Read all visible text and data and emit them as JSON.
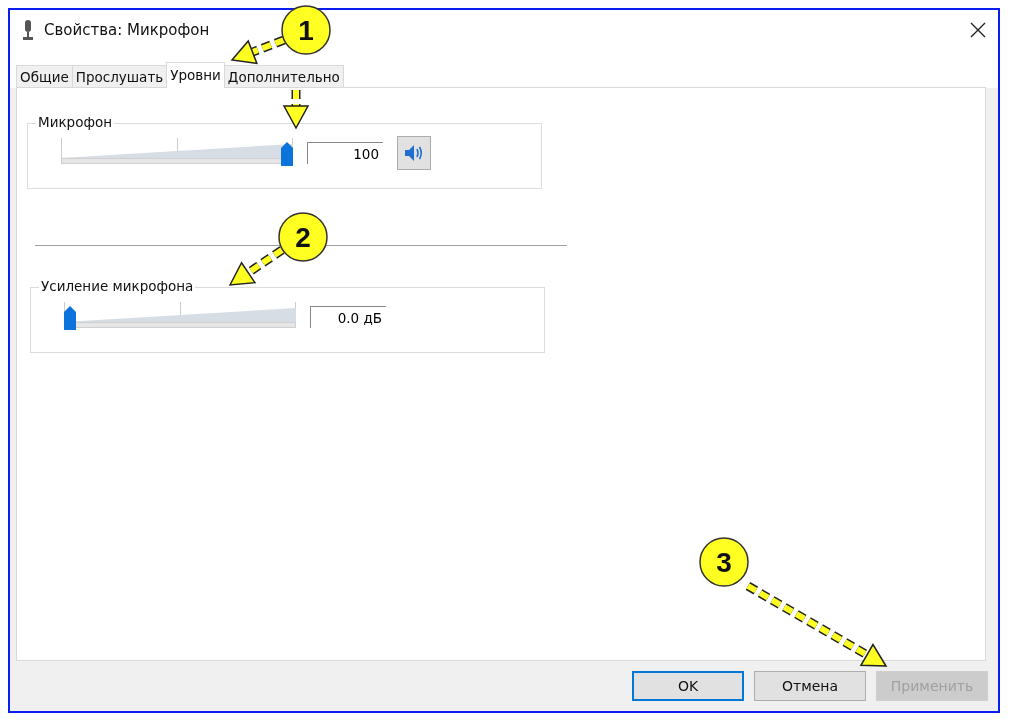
{
  "window": {
    "title": "Свойства: Микрофон"
  },
  "tabs": [
    {
      "label": "Общие",
      "selected": false
    },
    {
      "label": "Прослушать",
      "selected": false
    },
    {
      "label": "Уровни",
      "selected": true
    },
    {
      "label": "Дополнительно",
      "selected": false
    }
  ],
  "levels": [
    {
      "kind": "volume",
      "label": "Микрофон",
      "level": 1,
      "value": "100",
      "muted": false
    },
    {
      "kind": "boost",
      "label": "Усиление микрофона",
      "level": 0,
      "value": "0.0 дБ"
    }
  ],
  "buttons": [
    {
      "label": "OK",
      "default": true,
      "disabled": false
    },
    {
      "label": "Отмена",
      "default": false,
      "disabled": false
    },
    {
      "label": "Применить",
      "default": false,
      "disabled": true
    }
  ],
  "callouts": [
    {
      "number": "1"
    },
    {
      "number": "2"
    },
    {
      "number": "3"
    }
  ]
}
